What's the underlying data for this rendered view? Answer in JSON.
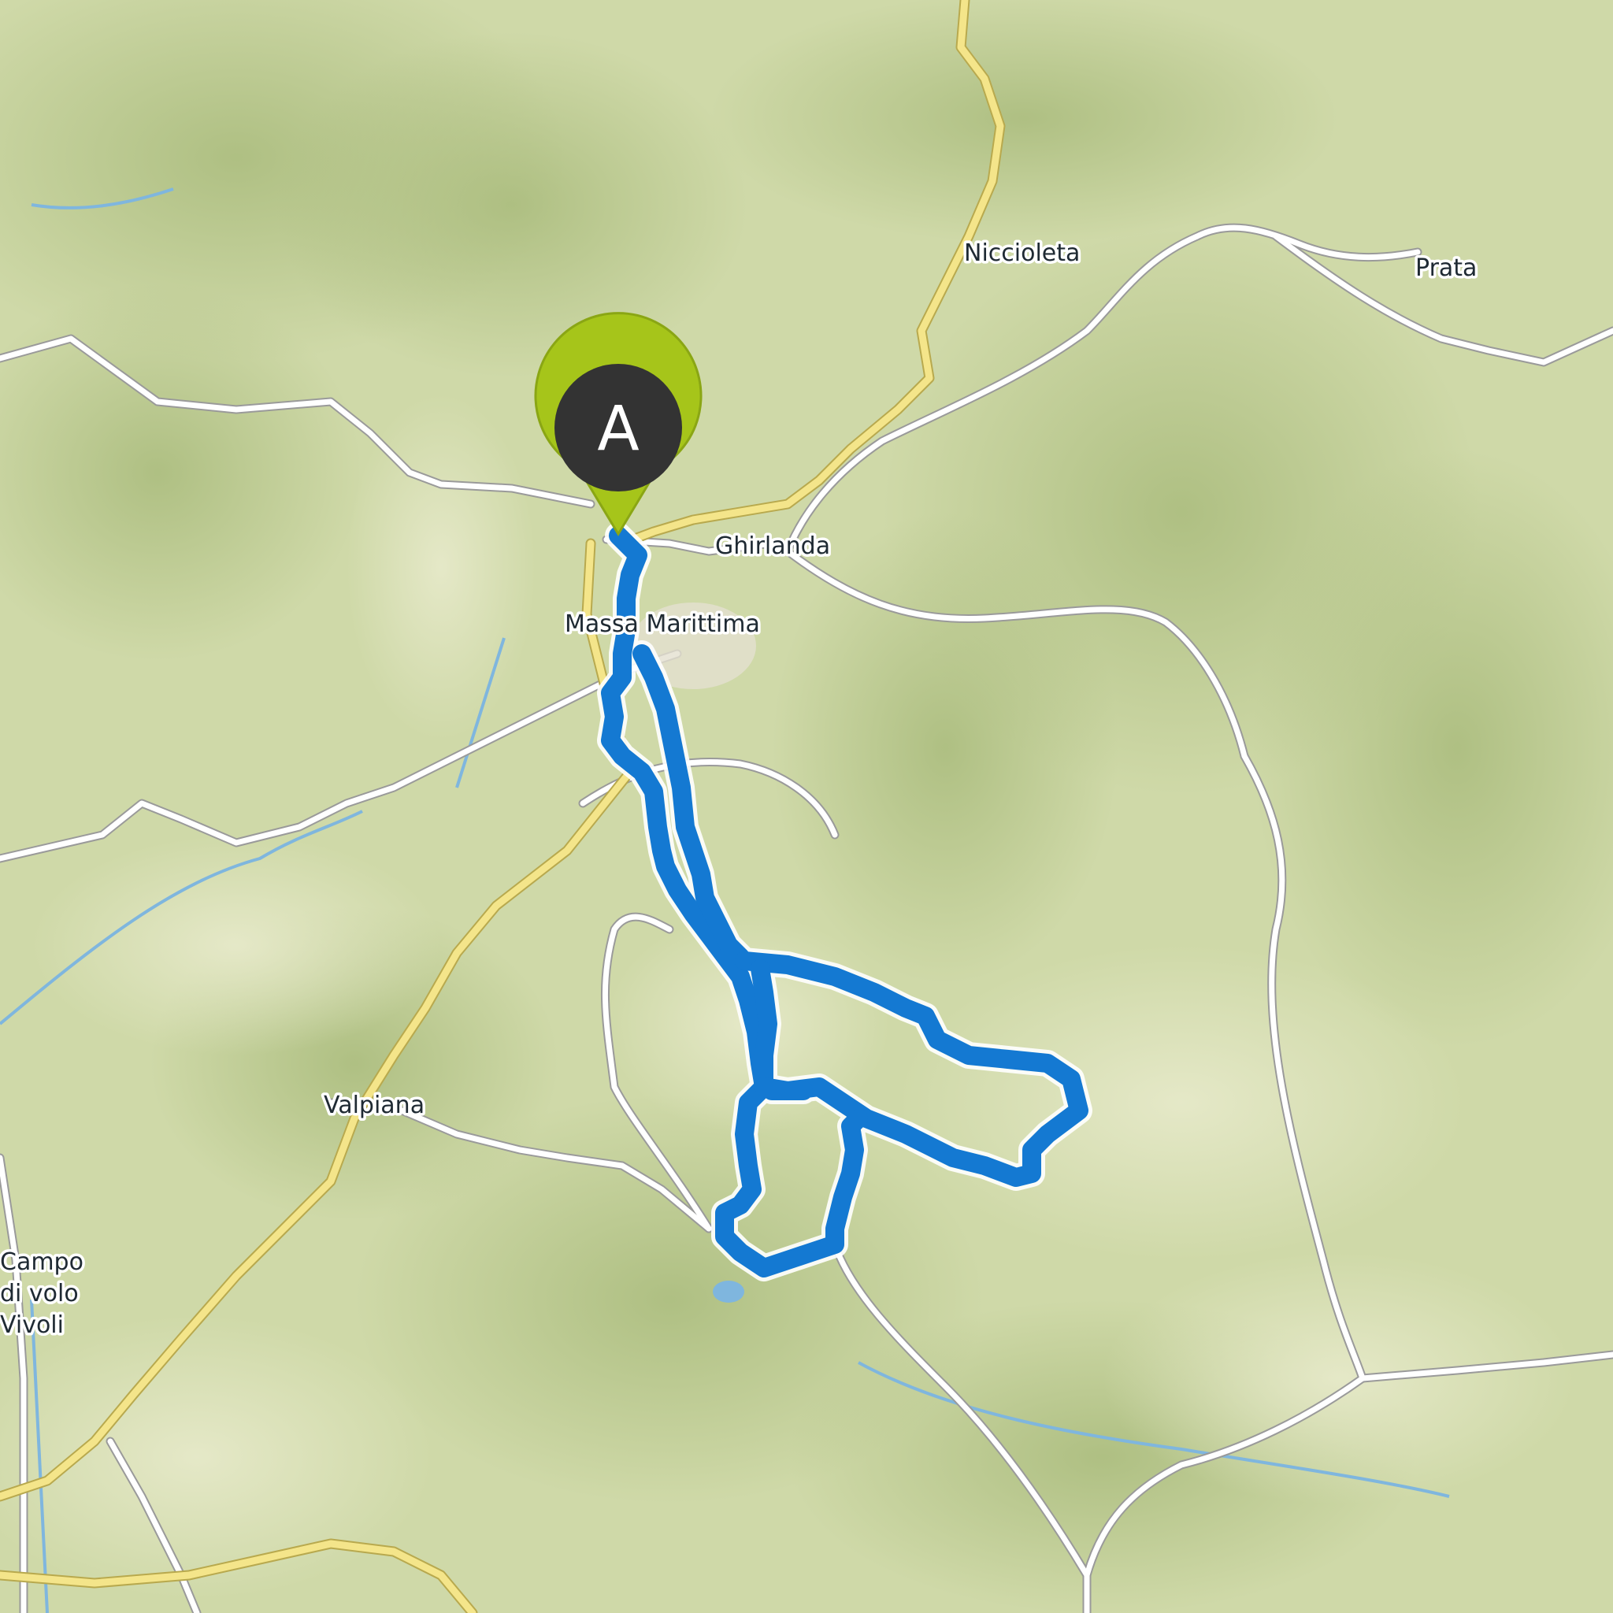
{
  "map": {
    "places": [
      {
        "id": "niccioleta",
        "label": "Niccioleta"
      },
      {
        "id": "prata",
        "label": "Prata"
      },
      {
        "id": "ghirlanda",
        "label": "Ghirlanda"
      },
      {
        "id": "massa-marittima",
        "label": "Massa Marittima"
      },
      {
        "id": "valpiana",
        "label": "Valpiana"
      },
      {
        "id": "campo-di-volo-line1",
        "label": "Campo"
      },
      {
        "id": "campo-di-volo-line2",
        "label": "di volo"
      },
      {
        "id": "campo-di-volo-line3",
        "label": "Vivoli"
      }
    ],
    "start_marker": {
      "label": "A"
    },
    "colors": {
      "route": "#1479d2",
      "marker_ring": "#a6c51a",
      "marker_body": "#333333",
      "main_road": "#f4e58a",
      "minor_road": "#ffffff",
      "water": "#7fb6de",
      "terrain": "#cfd9a8"
    }
  }
}
